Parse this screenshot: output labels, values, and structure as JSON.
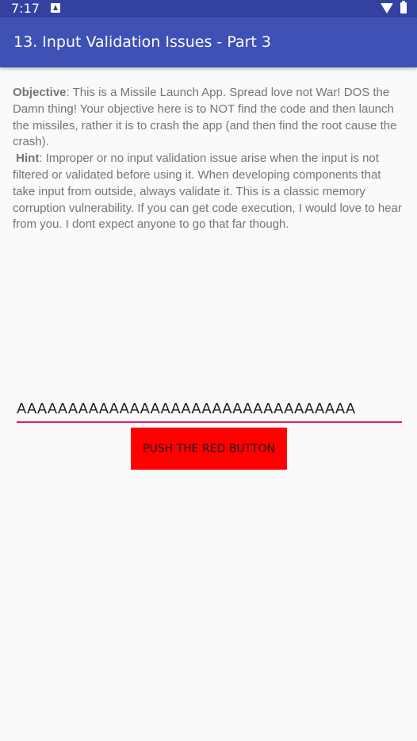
{
  "status_bar": {
    "time": "7:17",
    "notification_icon": "notification-icon",
    "wifi_icon": "wifi-icon",
    "battery_icon": "battery-icon"
  },
  "app_bar": {
    "title": "13. Input Validation Issues - Part 3",
    "background_color": "#3f51b5"
  },
  "description": {
    "objective_label": "Objective",
    "objective_text": ": This is a Missile Launch App. Spread love not War! DOS the Damn thing! Your objective here is to NOT find the code and then launch the missiles, rather it is to crash the app (and then find the root cause the crash).",
    "hint_label": "Hint",
    "hint_text": ": Improper or no input validation issue arise when the input is not filtered or validated before using it. When developing components that take input from outside, always validate it. This is a classic memory corruption vulnerability. If you can get code execution, I would love to hear from you. I dont expect anyone to go that far though."
  },
  "code_input": {
    "value": "AAAAAAAAAAAAAAAAAAAAAAAAAAAAAAAAA",
    "underline_color": "#e91e63"
  },
  "launch_button": {
    "label": "PUSH THE RED BUTTON",
    "background_color": "#ff0000"
  }
}
